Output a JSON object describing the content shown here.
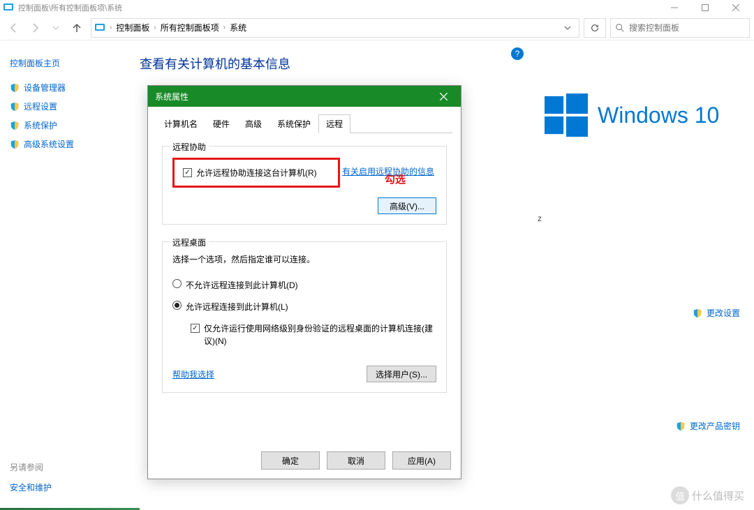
{
  "titlebar": {
    "path": "控制面板\\所有控制面板项\\系统"
  },
  "breadcrumbs": [
    "控制面板",
    "所有控制面板项",
    "系统"
  ],
  "search": {
    "placeholder": "搜索控制面板"
  },
  "sidebar": {
    "home": "控制面板主页",
    "items": [
      "设备管理器",
      "远程设置",
      "系统保护",
      "高级系统设置"
    ]
  },
  "main": {
    "title": "查看有关计算机的基本信息",
    "help": "?"
  },
  "right": {
    "brand_prefix": "Windows",
    "brand_suffix": "10",
    "mystery_char": "z",
    "change_settings": "更改设置",
    "change_key": "更改产品密钥"
  },
  "bottom_left": {
    "see_also": "另请参阅",
    "link": "安全和维护"
  },
  "dialog": {
    "title": "系统属性",
    "tabs": [
      "计算机名",
      "硬件",
      "高级",
      "系统保护",
      "远程"
    ],
    "active_tab": 4,
    "group1": {
      "title": "远程协助",
      "checkbox_label": "允许远程协助连接这台计算机(R)",
      "annotation": "勾选",
      "info_link": "有关启用远程协助的信息",
      "adv_button": "高级(V)..."
    },
    "group2": {
      "title": "远程桌面",
      "desc": "选择一个选项，然后指定谁可以连接。",
      "radio1": "不允许远程连接到此计算机(D)",
      "radio2": "允许远程连接到此计算机(L)",
      "sub_check": "仅允许运行使用网络级别身份验证的远程桌面的计算机连接(建议)(N)",
      "help_link": "帮助我选择",
      "select_users": "选择用户(S)..."
    },
    "footer": {
      "ok": "确定",
      "cancel": "取消",
      "apply": "应用(A)"
    }
  },
  "watermark": {
    "icon": "值",
    "text": "什么值得买"
  }
}
